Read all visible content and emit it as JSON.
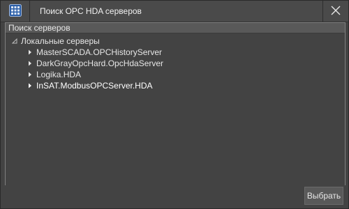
{
  "window": {
    "title": "Поиск OPC HDA серверов",
    "app_icon": "grid-app-icon",
    "close_icon": "close-icon"
  },
  "group": {
    "header": "Поиск серверов"
  },
  "tree": {
    "root": {
      "label": "Локальные серверы",
      "expanded": true,
      "icon": "collapse-triangle-icon"
    },
    "items": [
      {
        "label": "MasterSCADA.OPCHistoryServer",
        "icon": "expand-arrow-icon",
        "selected": false
      },
      {
        "label": "DarkGrayOpcHard.OpcHdaServer",
        "icon": "expand-arrow-icon",
        "selected": false
      },
      {
        "label": "Logika.HDA",
        "icon": "expand-arrow-icon",
        "selected": false
      },
      {
        "label": "InSAT.ModbusOPCServer.HDA",
        "icon": "expand-arrow-icon",
        "selected": true
      }
    ]
  },
  "footer": {
    "select_label": "Выбрать"
  },
  "colors": {
    "window_bg": "#434343",
    "titlebar_bg": "#4a4a4a",
    "header_bg": "#595959",
    "text": "#e6e6e6",
    "icon_blue": "#2c5fa8"
  }
}
